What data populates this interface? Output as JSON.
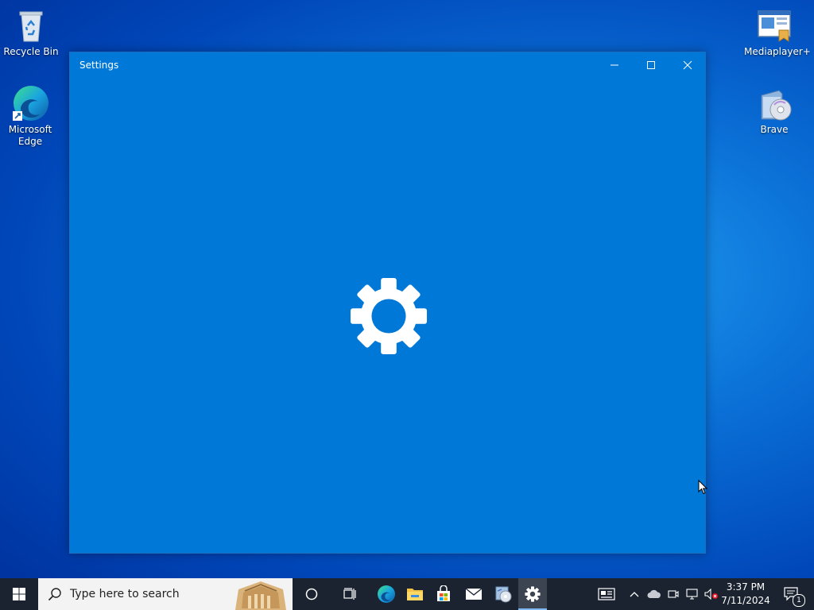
{
  "desktop": {
    "icons": [
      {
        "label": "Recycle Bin",
        "icon": "recycle-bin-icon"
      },
      {
        "label": "Microsoft Edge",
        "icon": "edge-icon"
      },
      {
        "label": "Mediaplayer+",
        "icon": "mediaplayer-icon"
      },
      {
        "label": "Brave",
        "icon": "brave-installer-icon"
      }
    ]
  },
  "window": {
    "title": "Settings",
    "background": "#0078d7",
    "controls": [
      "minimize-icon",
      "maximize-icon",
      "close-icon"
    ],
    "splash_icon": "gear-icon"
  },
  "taskbar": {
    "search_placeholder": "Type here to search",
    "pinned": [
      "cortana-icon",
      "task-view-icon",
      "edge-icon",
      "file-explorer-icon",
      "store-icon",
      "mail-icon",
      "photos-icon",
      "settings-icon"
    ],
    "active_app": "settings-icon",
    "tray": [
      "news-icon",
      "chevron-up-icon",
      "onedrive-icon",
      "meet-now-icon",
      "network-icon",
      "volume-muted-icon"
    ],
    "time": "3:37 PM",
    "date": "7/11/2024",
    "notification_count": "1"
  }
}
